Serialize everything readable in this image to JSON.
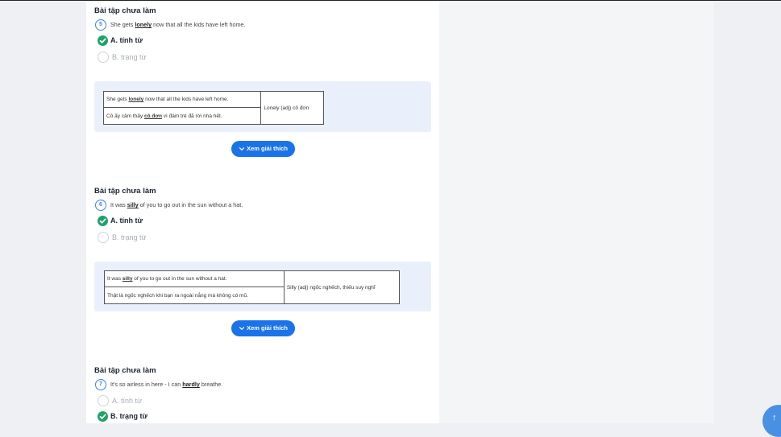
{
  "questions": [
    {
      "status": "Bài tập chưa làm",
      "number": "5",
      "text_before": "She gets ",
      "text_key": "lonely",
      "text_after": " now that all the kids have left home.",
      "option_a": "A. tính từ",
      "option_b": "B. trạng từ",
      "correct": "A",
      "table": {
        "en_before": "She gets ",
        "en_key": "lonely",
        "en_after": " now that all the kids have left home.",
        "vi_before": "Cô ấy cảm thấy ",
        "vi_key": "cô đơn",
        "vi_after": " vì đám trẻ đã rời nhà hết.",
        "definition": "Lonely (adj) cô đơn"
      },
      "button": "Xem giải thích"
    },
    {
      "status": "Bài tập chưa làm",
      "number": "6",
      "text_before": "It was ",
      "text_key": "silly",
      "text_after": " of you to go out in the sun without a hat.",
      "option_a": "A. tính từ",
      "option_b": "B. trạng từ",
      "correct": "A",
      "table": {
        "en_before": "It was ",
        "en_key": "silly",
        "en_after": " of you to go out in the sun without a hat.",
        "vi_full": "Thật là ngốc nghếch khi bạn ra ngoài nắng mà không có mũ.",
        "definition": "Silly (adj) ngốc nghếch, thiếu suy nghĩ"
      },
      "button": "Xem giải thích"
    },
    {
      "status": "Bài tập chưa làm",
      "number": "7",
      "text_before": "It's so airless in here - I can ",
      "text_key": "hardly",
      "text_after": " breathe.",
      "option_a": "A. tính từ",
      "option_b": "B. trạng từ",
      "correct": "B"
    }
  ],
  "colors": {
    "accent": "#1a73e8",
    "correct": "#1fa36a",
    "panel": "#eaf0fb"
  },
  "icons": {
    "check": "check-icon",
    "chevron": "chevron-down-icon",
    "scroll_top": "arrow-up-icon"
  },
  "scroll_top_glyph": "↑"
}
